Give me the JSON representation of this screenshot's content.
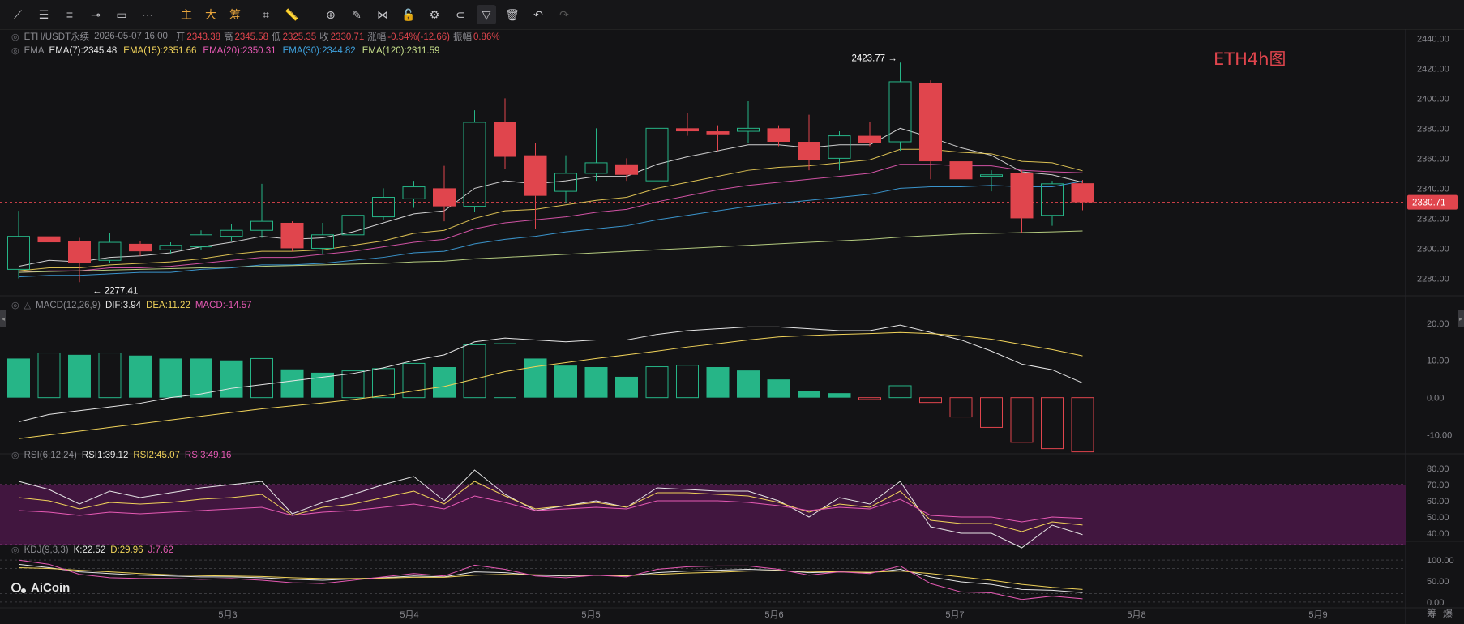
{
  "toolbar": {
    "text_buttons": [
      "主",
      "大",
      "筹"
    ],
    "icons": [
      "trendline-icon",
      "horizontal-lines-icon",
      "parallel-lines-icon",
      "horizontal-ray-icon",
      "rectangle-icon",
      "dotted-line-icon",
      "price-tag-icon",
      "ruler-icon",
      "zoom-icon",
      "brush-icon",
      "pattern-icon",
      "lock-icon",
      "settings-box-icon",
      "magnet-icon",
      "filter-icon",
      "trash-icon",
      "undo-icon",
      "redo-icon"
    ]
  },
  "header": {
    "symbol": "ETH/USDT永续",
    "datetime": "2026-05-07 16:00",
    "ohlc": [
      {
        "label": "开",
        "value": "2343.38"
      },
      {
        "label": "高",
        "value": "2345.58"
      },
      {
        "label": "低",
        "value": "2325.35"
      },
      {
        "label": "收",
        "value": "2330.71"
      },
      {
        "label": "涨幅",
        "value": "-0.54%(-12.66)"
      },
      {
        "label": "振幅",
        "value": "0.86%"
      }
    ],
    "ema_name": "EMA",
    "emas": [
      {
        "label": "EMA(7):2345.48",
        "color": "#e6e6e6"
      },
      {
        "label": "EMA(15):2351.66",
        "color": "#f1d35a"
      },
      {
        "label": "EMA(20):2350.31",
        "color": "#e65ab4"
      },
      {
        "label": "EMA(30):2344.82",
        "color": "#3fa3e0"
      },
      {
        "label": "EMA(120):2311.59",
        "color": "#c8e08c"
      }
    ]
  },
  "watermark": "ETH4h图",
  "colors": {
    "up": "#26b587",
    "down": "#e0454d"
  },
  "chart_data": [
    {
      "type": "candlestick",
      "title": "ETH/USDT永续",
      "ylim": [
        2270,
        2445
      ],
      "y_ticks": [
        2280,
        2300,
        2320,
        2340,
        2360,
        2380,
        2400,
        2420,
        2440
      ],
      "x_labels": [
        "5月3",
        "5月4",
        "5月5",
        "5月6",
        "5月7",
        "5月8",
        "5月9"
      ],
      "last_price": "2330.71",
      "annotations": {
        "high_label": "2423.77",
        "low_label": "← 2277.41",
        "high_value": 2423.77,
        "low_value": 2277.41
      },
      "candles": [
        {
          "o": 2286,
          "h": 2325,
          "l": 2280,
          "c": 2308
        },
        {
          "o": 2308,
          "h": 2313,
          "l": 2302,
          "c": 2304
        },
        {
          "o": 2305,
          "h": 2307,
          "l": 2277.41,
          "c": 2290
        },
        {
          "o": 2292,
          "h": 2310,
          "l": 2290,
          "c": 2304
        },
        {
          "o": 2303,
          "h": 2305,
          "l": 2295,
          "c": 2298
        },
        {
          "o": 2299,
          "h": 2304,
          "l": 2296,
          "c": 2302
        },
        {
          "o": 2301,
          "h": 2312,
          "l": 2299,
          "c": 2309
        },
        {
          "o": 2308,
          "h": 2316,
          "l": 2305,
          "c": 2312
        },
        {
          "o": 2312,
          "h": 2343,
          "l": 2307,
          "c": 2318
        },
        {
          "o": 2317,
          "h": 2318,
          "l": 2298,
          "c": 2300
        },
        {
          "o": 2300,
          "h": 2317,
          "l": 2296,
          "c": 2309
        },
        {
          "o": 2309,
          "h": 2328,
          "l": 2306,
          "c": 2322
        },
        {
          "o": 2321,
          "h": 2340,
          "l": 2319,
          "c": 2334
        },
        {
          "o": 2333,
          "h": 2345,
          "l": 2327,
          "c": 2341
        },
        {
          "o": 2340,
          "h": 2355,
          "l": 2318,
          "c": 2328
        },
        {
          "o": 2328,
          "h": 2392,
          "l": 2324,
          "c": 2384
        },
        {
          "o": 2384,
          "h": 2400,
          "l": 2353,
          "c": 2361
        },
        {
          "o": 2362,
          "h": 2370,
          "l": 2313,
          "c": 2335
        },
        {
          "o": 2338,
          "h": 2362,
          "l": 2330,
          "c": 2350
        },
        {
          "o": 2350,
          "h": 2380,
          "l": 2345,
          "c": 2357
        },
        {
          "o": 2356,
          "h": 2360,
          "l": 2345,
          "c": 2349
        },
        {
          "o": 2345,
          "h": 2388,
          "l": 2343,
          "c": 2380
        },
        {
          "o": 2380,
          "h": 2390,
          "l": 2375,
          "c": 2378
        },
        {
          "o": 2378,
          "h": 2382,
          "l": 2365,
          "c": 2376
        },
        {
          "o": 2378,
          "h": 2398,
          "l": 2370,
          "c": 2380
        },
        {
          "o": 2380,
          "h": 2382,
          "l": 2368,
          "c": 2371
        },
        {
          "o": 2371,
          "h": 2389,
          "l": 2352,
          "c": 2359
        },
        {
          "o": 2360,
          "h": 2378,
          "l": 2352,
          "c": 2375
        },
        {
          "o": 2375,
          "h": 2384,
          "l": 2368,
          "c": 2370
        },
        {
          "o": 2371,
          "h": 2423.77,
          "l": 2365,
          "c": 2411
        },
        {
          "o": 2410,
          "h": 2412,
          "l": 2346,
          "c": 2358
        },
        {
          "o": 2358,
          "h": 2366,
          "l": 2337,
          "c": 2346
        },
        {
          "o": 2348,
          "h": 2352,
          "l": 2338,
          "c": 2349
        },
        {
          "o": 2350,
          "h": 2352,
          "l": 2310,
          "c": 2320
        },
        {
          "o": 2322,
          "h": 2345,
          "l": 2315,
          "c": 2343
        },
        {
          "o": 2343.38,
          "h": 2345.58,
          "l": 2325.35,
          "c": 2330.71
        }
      ],
      "ema": [
        {
          "name": "EMA(7)",
          "color": "#e6e6e6",
          "values": [
            2288,
            2292,
            2291,
            2294,
            2295,
            2297,
            2301,
            2304,
            2308,
            2306,
            2307,
            2311,
            2317,
            2323,
            2325,
            2340,
            2345,
            2343,
            2345,
            2348,
            2348,
            2356,
            2361,
            2365,
            2369,
            2369,
            2367,
            2369,
            2369,
            2380,
            2374,
            2367,
            2362,
            2351,
            2349,
            2344
          ]
        },
        {
          "name": "EMA(15)",
          "color": "#f1d35a",
          "values": [
            2285,
            2287,
            2287,
            2289,
            2290,
            2291,
            2293,
            2296,
            2298,
            2298,
            2299,
            2302,
            2305,
            2310,
            2312,
            2320,
            2325,
            2326,
            2329,
            2332,
            2334,
            2340,
            2344,
            2348,
            2352,
            2354,
            2355,
            2357,
            2359,
            2366,
            2366,
            2364,
            2363,
            2358,
            2357,
            2351.66
          ]
        },
        {
          "name": "EMA(20)",
          "color": "#e65ab4",
          "values": [
            2284,
            2285,
            2285,
            2287,
            2287,
            2288,
            2290,
            2292,
            2294,
            2294,
            2296,
            2298,
            2301,
            2304,
            2306,
            2313,
            2317,
            2319,
            2321,
            2324,
            2326,
            2331,
            2335,
            2339,
            2342,
            2344,
            2346,
            2348,
            2350,
            2356,
            2356,
            2355,
            2355,
            2352,
            2351,
            2350.31
          ]
        },
        {
          "name": "EMA(30)",
          "color": "#3fa3e0",
          "values": [
            2281,
            2282,
            2282,
            2283,
            2284,
            2284,
            2286,
            2287,
            2289,
            2289,
            2290,
            2292,
            2294,
            2297,
            2298,
            2303,
            2306,
            2308,
            2311,
            2313,
            2315,
            2319,
            2322,
            2325,
            2328,
            2330,
            2332,
            2334,
            2336,
            2340,
            2341,
            2341,
            2342,
            2341,
            2341,
            2344.82
          ]
        },
        {
          "name": "EMA(120)",
          "color": "#c8e08c",
          "values": [
            2284,
            2284.5,
            2285,
            2285.5,
            2286,
            2286.5,
            2287,
            2287.5,
            2288,
            2288.5,
            2289,
            2289.5,
            2290,
            2291,
            2291.5,
            2293,
            2294,
            2295,
            2296,
            2297,
            2298,
            2299,
            2300,
            2301,
            2302,
            2303,
            2304,
            2305,
            2306,
            2307.5,
            2308.5,
            2309.5,
            2310,
            2310.5,
            2311,
            2311.59
          ]
        }
      ]
    },
    {
      "type": "bar",
      "title": "MACD(12,26,9)",
      "labels": {
        "dif": "DIF:3.94",
        "dea": "DEA:11.22",
        "macd": "MACD:-14.57"
      },
      "ylim": [
        -14,
        23
      ],
      "y_ticks": [
        -10,
        0,
        10,
        20
      ],
      "y_tick_labels": [
        "-10.00",
        "0.00",
        "10.00",
        "20.00"
      ],
      "hist": [
        10.5,
        12,
        11.5,
        12,
        11.3,
        10.5,
        10.5,
        10,
        10.5,
        7.6,
        6.7,
        7.2,
        7.8,
        9.2,
        8.2,
        14.2,
        14.5,
        10.5,
        8.6,
        8.2,
        5.6,
        8.3,
        8.7,
        8.2,
        7.3,
        4.9,
        1.7,
        1.2,
        -0.5,
        3.2,
        -1.3,
        -5.2,
        -8,
        -12,
        -13.7,
        -14.57
      ],
      "dif": [
        -6.5,
        -4.5,
        -3.5,
        -2.5,
        -1.5,
        0,
        1,
        2.5,
        3.5,
        4.5,
        5.5,
        6.5,
        8,
        10,
        11.5,
        15,
        16,
        15.5,
        15,
        15.5,
        15.5,
        17,
        18,
        18.5,
        19,
        19,
        18.5,
        18,
        18,
        19.5,
        17.5,
        15.5,
        12.5,
        9,
        7.5,
        3.94
      ],
      "dea": [
        -11,
        -10,
        -9,
        -8,
        -7,
        -6,
        -5,
        -4,
        -3,
        -2.2,
        -1.4,
        -0.5,
        0.5,
        1.8,
        3,
        5,
        7,
        8.3,
        9.4,
        10.5,
        11.5,
        12.5,
        13.6,
        14.5,
        15.5,
        16.3,
        16.7,
        17,
        17.2,
        17.5,
        17.2,
        16.6,
        15.7,
        14.3,
        12.9,
        11.22
      ]
    },
    {
      "type": "line",
      "title": "RSI(6,12,24)",
      "labels": [
        "RSI1:39.12",
        "RSI2:45.07",
        "RSI3:49.16"
      ],
      "ylim": [
        30,
        85
      ],
      "band": [
        33,
        70
      ],
      "y_ticks": [
        40,
        50,
        60,
        70,
        80
      ],
      "y_tick_labels": [
        "40.00",
        "50.00",
        "60.00",
        "70.00",
        "80.00"
      ],
      "series": [
        {
          "name": "RSI1",
          "color": "#e6e6e6",
          "values": [
            72,
            67,
            58,
            66,
            62,
            65,
            68,
            70,
            72,
            52,
            59,
            64,
            70,
            75,
            60,
            79,
            64,
            54,
            57,
            60,
            56,
            68,
            67,
            66,
            66,
            60,
            50,
            62,
            58,
            72,
            44,
            40,
            40,
            31,
            45,
            39.12
          ]
        },
        {
          "name": "RSI2",
          "color": "#f1d35a",
          "values": [
            62,
            60,
            55,
            59,
            58,
            59,
            61,
            62,
            64,
            51,
            56,
            58,
            62,
            66,
            58,
            72,
            63,
            55,
            57,
            59,
            56,
            65,
            65,
            64,
            63,
            59,
            53,
            58,
            56,
            66,
            48,
            46,
            46,
            41,
            47,
            45.07
          ]
        },
        {
          "name": "RSI3",
          "color": "#e65ab4",
          "values": [
            54,
            53,
            51,
            53,
            52,
            53,
            54,
            55,
            56,
            51,
            53,
            54,
            56,
            58,
            55,
            63,
            59,
            54,
            55,
            56,
            55,
            60,
            60,
            60,
            59,
            57,
            54,
            56,
            55,
            61,
            51,
            50,
            50,
            47,
            50,
            49.16
          ]
        }
      ]
    },
    {
      "type": "line",
      "title": "KDJ(9,3,3)",
      "labels": [
        "K:22.52",
        "D:29.96",
        "J:7.62"
      ],
      "ylim": [
        -10,
        110
      ],
      "y_ticks": [
        0,
        50,
        100
      ],
      "y_tick_labels": [
        "0.00",
        "50.00",
        "100.00"
      ],
      "series": [
        {
          "name": "K",
          "color": "#e6e6e6",
          "values": [
            90,
            82,
            72,
            68,
            64,
            62,
            60,
            60,
            58,
            54,
            52,
            55,
            58,
            62,
            60,
            72,
            70,
            64,
            62,
            64,
            62,
            70,
            74,
            76,
            78,
            76,
            70,
            72,
            70,
            78,
            60,
            48,
            42,
            30,
            28,
            22.52
          ]
        },
        {
          "name": "D",
          "color": "#f1d35a",
          "values": [
            82,
            80,
            76,
            72,
            68,
            65,
            63,
            62,
            61,
            58,
            56,
            56,
            57,
            59,
            59,
            64,
            66,
            65,
            64,
            64,
            63,
            66,
            69,
            71,
            74,
            75,
            73,
            72,
            71,
            74,
            68,
            60,
            52,
            42,
            35,
            29.96
          ]
        },
        {
          "name": "J",
          "color": "#e65ab4",
          "values": [
            100,
            90,
            66,
            58,
            56,
            56,
            54,
            56,
            52,
            46,
            44,
            52,
            60,
            68,
            62,
            88,
            78,
            62,
            58,
            64,
            60,
            78,
            84,
            86,
            86,
            78,
            64,
            72,
            68,
            86,
            44,
            24,
            22,
            6,
            14,
            7.62
          ]
        }
      ]
    }
  ],
  "footer": {
    "logo": "AiCoin",
    "buttons": [
      "筹",
      "爆"
    ]
  }
}
